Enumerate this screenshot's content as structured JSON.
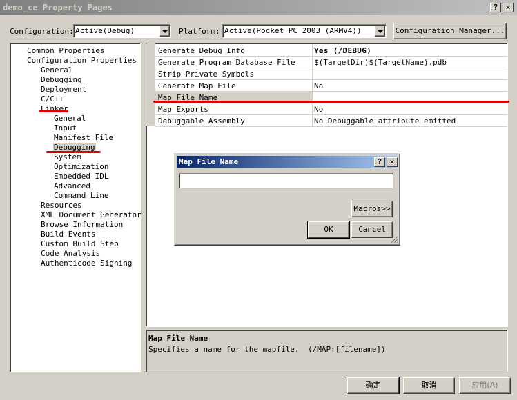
{
  "window": {
    "title": "demo_ce Property Pages",
    "help_btn": "?",
    "close_btn": "✕"
  },
  "toolbar": {
    "configuration_label": "Configuration:",
    "configuration_value": "Active(Debug)",
    "platform_label": "Platform:",
    "platform_value": "Active(Pocket PC 2003 (ARMV4))",
    "config_manager_label": "Configuration Manager..."
  },
  "tree": {
    "common": "Common Properties",
    "config": "Configuration Properties",
    "general": "General",
    "debugging": "Debugging",
    "deployment": "Deployment",
    "cpp": "C/C++",
    "linker": "Linker",
    "linker_general": "General",
    "linker_input": "Input",
    "linker_manifest": "Manifest File",
    "linker_debugging": "Debugging",
    "linker_system": "System",
    "linker_optimization": "Optimization",
    "linker_embedded_idl": "Embedded IDL",
    "linker_advanced": "Advanced",
    "linker_command_line": "Command Line",
    "resources": "Resources",
    "xml_doc": "XML Document Generator",
    "browse": "Browse Information",
    "build_events": "Build Events",
    "custom_build": "Custom Build Step",
    "code_analysis": "Code Analysis",
    "authenticode": "Authenticode Signing"
  },
  "grid": {
    "rows": [
      {
        "name": "Generate Debug Info",
        "value": "Yes (/DEBUG)"
      },
      {
        "name": "Generate Program Database File",
        "value": "$(TargetDir)$(TargetName).pdb"
      },
      {
        "name": "Strip Private Symbols",
        "value": ""
      },
      {
        "name": "Generate Map File",
        "value": "No"
      },
      {
        "name": "Map File Name",
        "value": ""
      },
      {
        "name": "Map Exports",
        "value": "No"
      },
      {
        "name": "Debuggable Assembly",
        "value": "No Debuggable attribute emitted"
      }
    ]
  },
  "description": {
    "title": "Map File Name",
    "text": "Specifies a name for the mapfile.",
    "switch": "(/MAP:[filename])"
  },
  "dialog": {
    "title": "Map File Name",
    "help_btn": "?",
    "close_btn": "✕",
    "input_value": "",
    "macros_label": "Macros>>",
    "ok_label": "OK",
    "cancel_label": "Cancel"
  },
  "buttons": {
    "ok": "确定",
    "cancel": "取消",
    "apply": "应用(A)"
  },
  "colors": {
    "annotation_red": "#e00000",
    "face": "#d4d0c8"
  }
}
